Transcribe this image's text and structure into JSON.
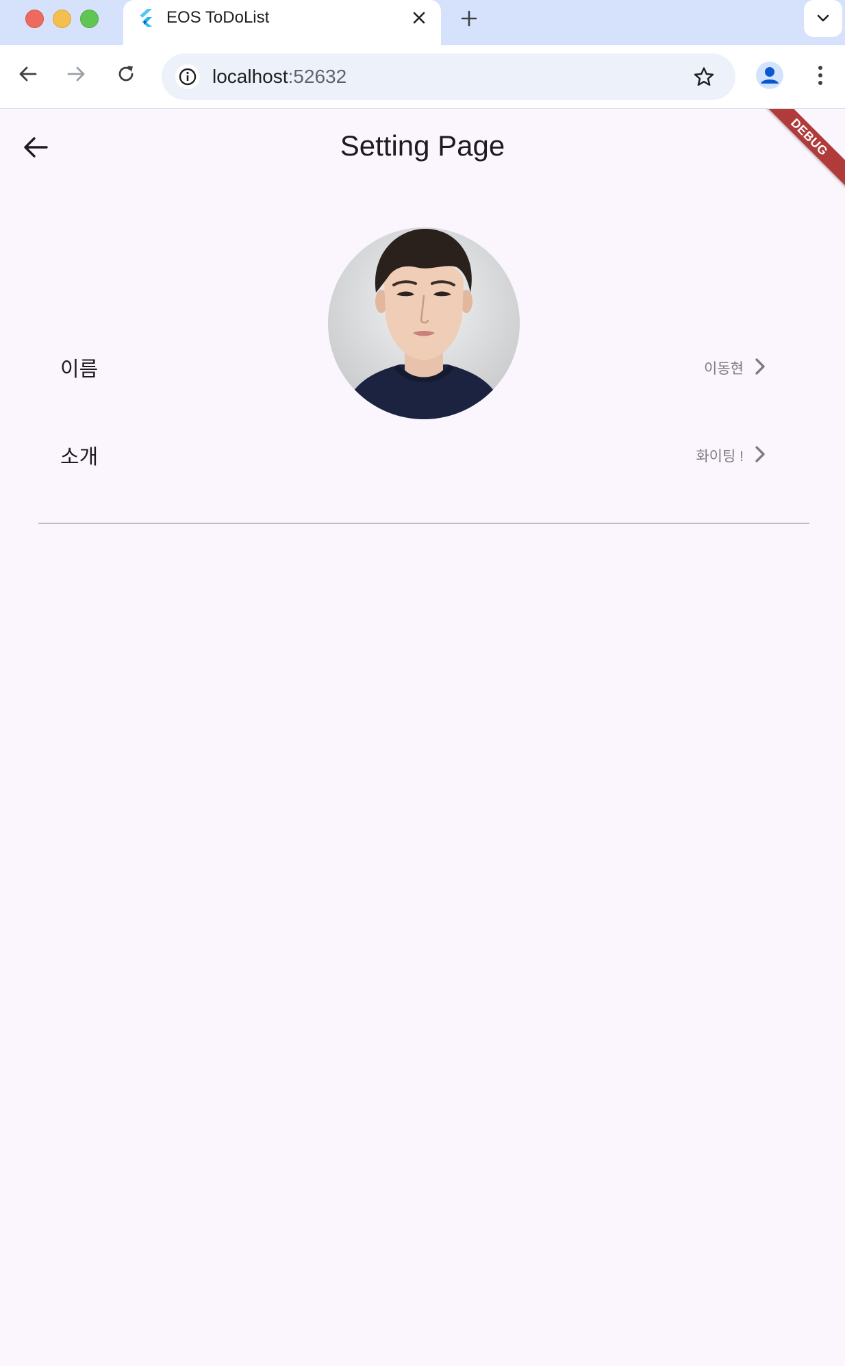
{
  "browser": {
    "tab": {
      "title": "EOS ToDoList",
      "favicon": "flutter-logo-icon",
      "close_icon": "close-icon"
    },
    "new_tab_icon": "plus-icon",
    "tab_search_icon": "chevron-down-icon",
    "nav": {
      "back_icon": "arrow-left-icon",
      "forward_icon": "arrow-right-icon",
      "reload_icon": "reload-icon"
    },
    "address": {
      "host": "localhost",
      "port": ":52632",
      "site_info_icon": "info-icon",
      "bookmark_icon": "star-icon"
    },
    "profile_icon": "person-icon",
    "menu_icon": "more-vert-icon"
  },
  "app": {
    "title": "Setting Page",
    "back_icon": "arrow-left-icon",
    "debug_banner": "DEBUG",
    "profile_image": "profile-photo",
    "rows": [
      {
        "label": "이름",
        "value": "이동현",
        "chevron": "chevron-right-icon"
      },
      {
        "label": "소개",
        "value": "화이팅 !",
        "chevron": "chevron-right-icon"
      }
    ]
  },
  "colors": {
    "tabstrip": "#d6e2fb",
    "app_background": "#fbf6fd",
    "debug_banner": "#b13b3b",
    "secondary_text": "#7d7a80"
  }
}
